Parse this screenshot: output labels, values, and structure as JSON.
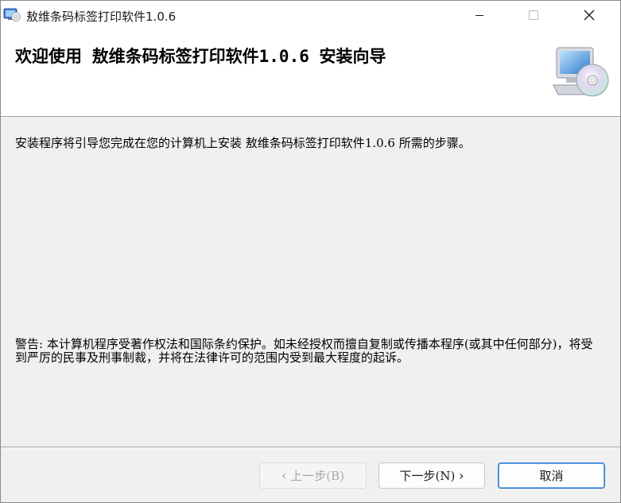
{
  "window": {
    "title": "敖维条码标签打印软件1.0.6"
  },
  "banner": {
    "title": "欢迎使用 敖维条码标签打印软件1.0.6 安装向导",
    "icon": "computer-cd-icon"
  },
  "content": {
    "intro": "安装程序将引导您完成在您的计算机上安装 敖维条码标签打印软件1.0.6 所需的步骤。",
    "warning": "警告: 本计算机程序受著作权法和国际条约保护。如未经授权而擅自复制或传播本程序(或其中任何部分)，将受到严厉的民事及刑事制裁，并将在法律许可的范围内受到最大程度的起诉。"
  },
  "buttons": {
    "back_label": "上一步(B)",
    "next_label": "下一步(N)",
    "cancel_label": "取消"
  },
  "colors": {
    "accent": "#2f7bd2",
    "disabled_text": "#a8a8a8",
    "dialog_background": "#f0f0f0"
  }
}
